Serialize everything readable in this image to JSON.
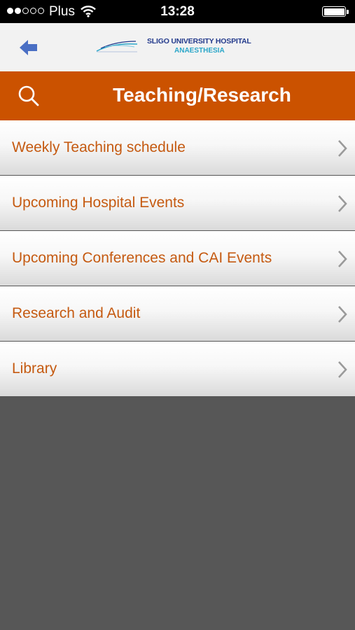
{
  "status_bar": {
    "carrier": "Plus",
    "time": "13:28",
    "signal_dots": [
      true,
      true,
      false,
      false,
      false
    ],
    "battery_level": 1.0
  },
  "header": {
    "logo_title": "SLIGO UNIVERSITY HOSPITAL",
    "logo_subtitle": "ANAESTHESIA",
    "back_icon": "arrow-left-icon",
    "colors": {
      "logo_title": "#233a8c",
      "logo_subtitle": "#2aa6c9",
      "back_arrow": "#4a6fc4"
    }
  },
  "title_bar": {
    "title": "Teaching/Research",
    "search_icon": "search-icon",
    "background": "#cb5200"
  },
  "menu": {
    "items": [
      {
        "label": "Weekly Teaching schedule"
      },
      {
        "label": "Upcoming Hospital Events"
      },
      {
        "label": "Upcoming Conferences and CAI Events"
      },
      {
        "label": "Research and Audit"
      },
      {
        "label": "Library"
      }
    ],
    "label_color": "#c55a11",
    "chevron_icon": "chevron-right-icon"
  },
  "colors": {
    "empty_area": "#575757"
  }
}
